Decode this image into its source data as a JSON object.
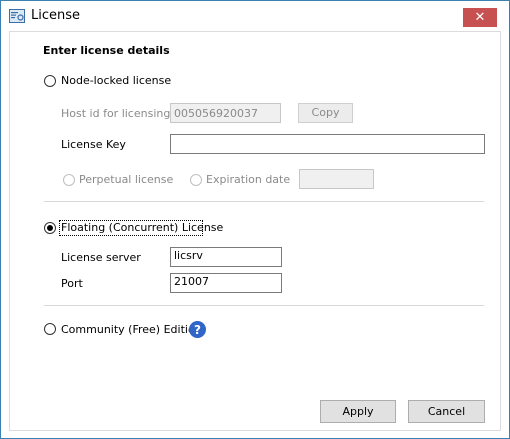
{
  "window": {
    "title": "License",
    "close_symbol": "✕"
  },
  "form": {
    "heading": "Enter license details",
    "node_locked": {
      "label": "Node-locked license",
      "selected": false,
      "host_id_label": "Host id for licensing",
      "host_id_value": "005056920037",
      "copy_label": "Copy",
      "license_key_label": "License Key",
      "license_key_value": "",
      "perpetual_label": "Perpetual license",
      "expiration_label": "Expiration date",
      "expiration_value": ""
    },
    "floating": {
      "label": "Floating (Concurrent) License",
      "selected": true,
      "server_label": "License server",
      "server_value": "licsrv",
      "port_label": "Port",
      "port_value": "21007"
    },
    "community": {
      "label": "Community (Free) Edition",
      "selected": false,
      "help_symbol": "?"
    }
  },
  "buttons": {
    "apply": "Apply",
    "cancel": "Cancel"
  },
  "colors": {
    "close_button": "#c75050",
    "help_icon": "#2f66c7",
    "window_border": "#3c7fb1"
  },
  "icons": {
    "app": "license-icon",
    "close": "close-icon",
    "help": "help-icon"
  }
}
